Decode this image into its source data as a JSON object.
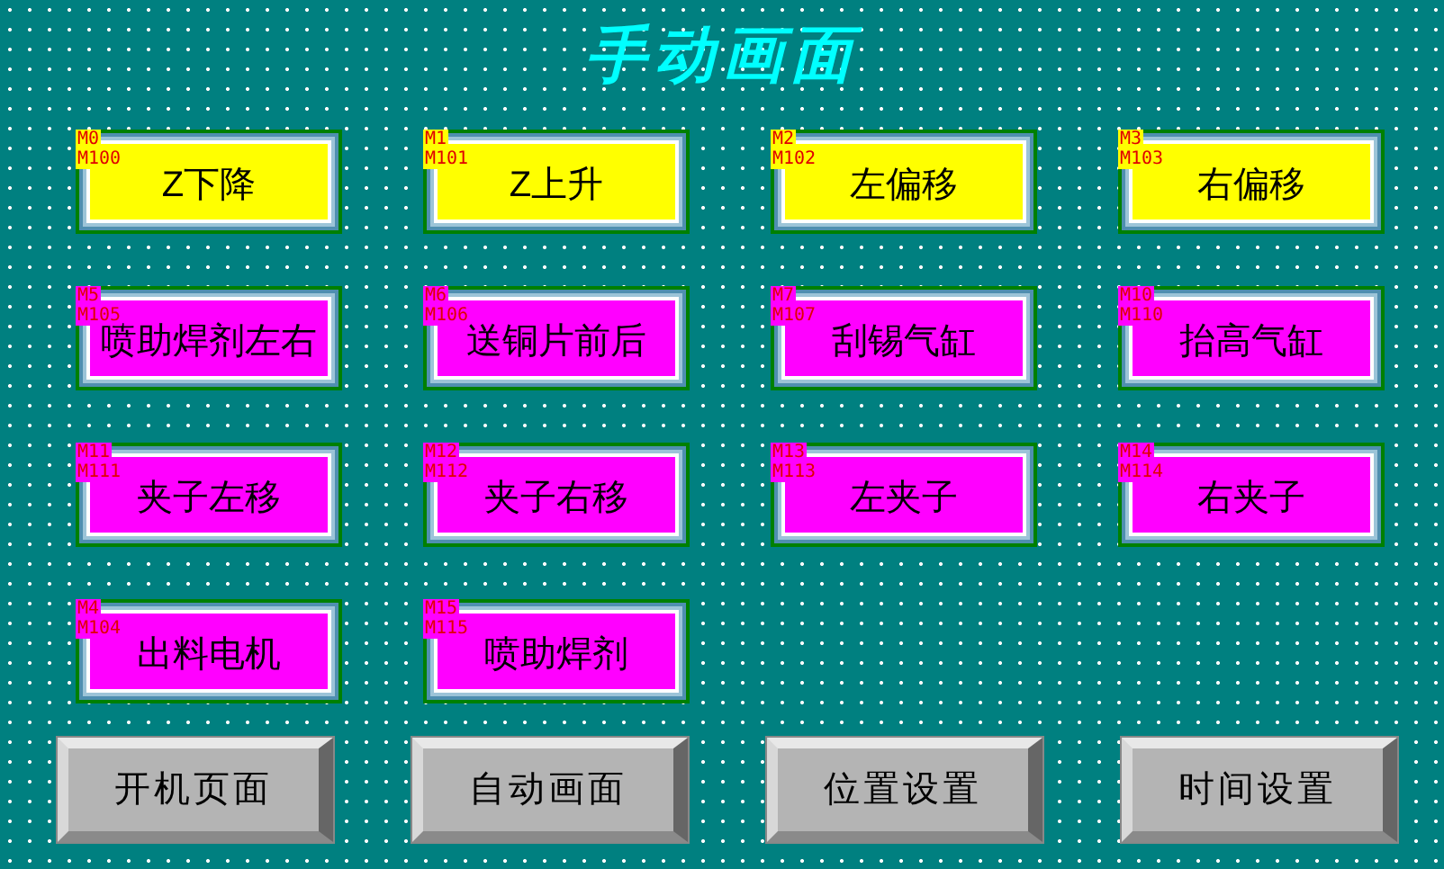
{
  "title": "手动画面",
  "buttons": [
    {
      "label": "Z下降",
      "tags": [
        "M0",
        "M100"
      ],
      "color": "#ffff00"
    },
    {
      "label": "Z上升",
      "tags": [
        "M1",
        "M101"
      ],
      "color": "#ffff00"
    },
    {
      "label": "左偏移",
      "tags": [
        "M2",
        "M102"
      ],
      "color": "#ffff00"
    },
    {
      "label": "右偏移",
      "tags": [
        "M3",
        "M103"
      ],
      "color": "#ffff00"
    },
    {
      "label": "喷助焊剂左右",
      "tags": [
        "M5",
        "M105"
      ],
      "color": "#ff00ff"
    },
    {
      "label": "送铜片前后",
      "tags": [
        "M6",
        "M106"
      ],
      "color": "#ff00ff"
    },
    {
      "label": "刮锡气缸",
      "tags": [
        "M7",
        "M107"
      ],
      "color": "#ff00ff"
    },
    {
      "label": "抬高气缸",
      "tags": [
        "M10",
        "M110"
      ],
      "color": "#ff00ff"
    },
    {
      "label": "夹子左移",
      "tags": [
        "M11",
        "M111"
      ],
      "color": "#ff00ff"
    },
    {
      "label": "夹子右移",
      "tags": [
        "M12",
        "M112"
      ],
      "color": "#ff00ff"
    },
    {
      "label": "左夹子",
      "tags": [
        "M13",
        "M113"
      ],
      "color": "#ff00ff"
    },
    {
      "label": "右夹子",
      "tags": [
        "M14",
        "M114"
      ],
      "color": "#ff00ff"
    },
    {
      "label": "出料电机",
      "tags": [
        "M4",
        "M104"
      ],
      "color": "#ff00ff"
    },
    {
      "label": "喷助焊剂",
      "tags": [
        "M15",
        "M115"
      ],
      "color": "#ff00ff"
    }
  ],
  "navigation": [
    "开机页面",
    "自动画面",
    "位置设置",
    "时间设置"
  ]
}
